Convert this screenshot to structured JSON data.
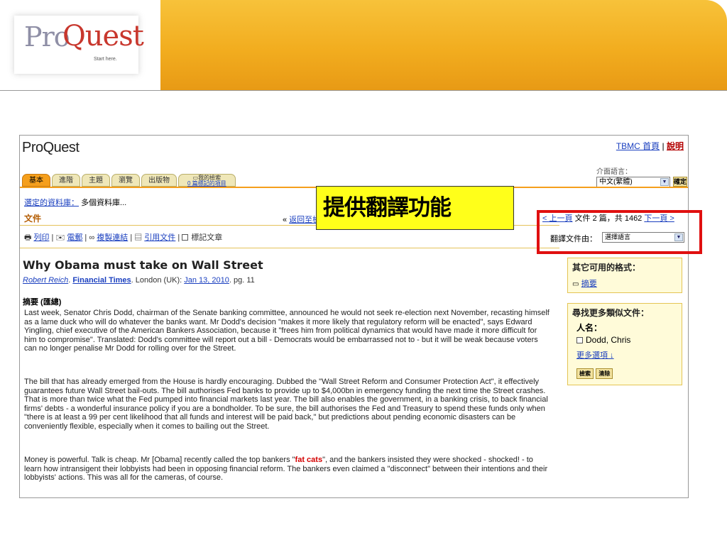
{
  "logo": {
    "pro": "Pro",
    "quest": "Quest",
    "tagline": "Start here."
  },
  "app": {
    "brand": "ProQuest",
    "home_link": "TBMC 首頁",
    "separator": "|",
    "help_link": "說明"
  },
  "interface_language": {
    "label": "介面語言：",
    "selected": "中文(繁體)",
    "ok_button": "確定"
  },
  "tabs": [
    {
      "label": "基本",
      "active": true
    },
    {
      "label": "進階"
    },
    {
      "label": "主題"
    },
    {
      "label": "瀏覽"
    },
    {
      "label": "出版物"
    }
  ],
  "my_search": {
    "label": "我的檢索",
    "marked": "0 篇標記的項目"
  },
  "databases": {
    "link": "選定的資料庫：",
    "value": "多個資料庫..."
  },
  "document_heading": "文件",
  "back_link": {
    "prefix": "«",
    "link": "返回至檢"
  },
  "pager": {
    "prev": "< 上一頁",
    "info": "文件 2 篇，共 1462",
    "next": "下一頁 >"
  },
  "translate": {
    "label": "翻譯文件由：",
    "selected": "選擇語言"
  },
  "actions": {
    "print": "列印",
    "email": "電郵",
    "copy_link": "複製連結",
    "cite": "引用文件",
    "mark": "標記文章"
  },
  "article": {
    "title": "Why Obama must take on Wall Street",
    "author": "Robert Reich",
    "source": "Financial Times",
    "location": ". London (UK): ",
    "date": "Jan 13, 2010",
    "page": ". pg. 11",
    "abstract_heading": "摘要 (匯總)",
    "para1": "Last week, Senator Chris Dodd, chairman of the Senate banking committee, announced he would not seek re-election next November, recasting himself as a lame duck who will do whatever the banks want. Mr Dodd's decision \"makes it more likely that regulatory reform will be enacted\", says Edward Yingling, chief executive of the American Bankers Association, because it \"frees him from political dynamics that would have made it more difficult for him to compromise\". Translated: Dodd's committee will report out a bill - Democrats would be embarrassed not to - but it will be weak because voters can no longer penalise Mr Dodd for rolling over for the Street.",
    "para2": "The bill that has already emerged from the House is hardly encouraging. Dubbed the \"Wall Street Reform and Consumer Protection Act\", it effectively guarantees future Wall Street bail-outs. The bill authorises Fed banks to provide up to $4,000bn in emergency funding the next time the Street crashes. That is more than twice what the Fed pumped into financial markets last year. The bill also enables the government, in a banking crisis, to back financial firms' debts - a wonderful insurance policy if you are a bondholder. To be sure, the bill authorises the Fed and Treasury to spend these funds only when \"there is at least a 99 per cent likelihood that all funds and interest will be paid back,\" but predictions about pending economic disasters can be conveniently flexible, especially when it comes to bailing out the Street.",
    "para3_a": "Money is powerful. Talk is cheap. Mr [Obama] recently called the top bankers \"",
    "para3_hl": "fat cats",
    "para3_b": "\", and the bankers insisted they were shocked - shocked! - to learn how intransigent their lobbyists had been in opposing financial reform. The bankers even claimed a \"disconnect\" between their intentions and their lobbyists' actions. This was all for the cameras, of course."
  },
  "formats_box": {
    "heading": "其它可用的格式：",
    "abstract_link": "摘要"
  },
  "similar_box": {
    "heading": "尋找更多類似文件：",
    "person_label": "人名：",
    "person": "Dodd, Chris",
    "more_options": "更多選項 ↓",
    "search_button": "檢索",
    "clear_button": "清除"
  },
  "callout": "提供翻譯功能",
  "colors": {
    "accent_orange": "#f59f1c",
    "link_blue": "#1a3fbf",
    "highlight_red": "#e01010",
    "callout_yellow": "#ffff1a"
  }
}
